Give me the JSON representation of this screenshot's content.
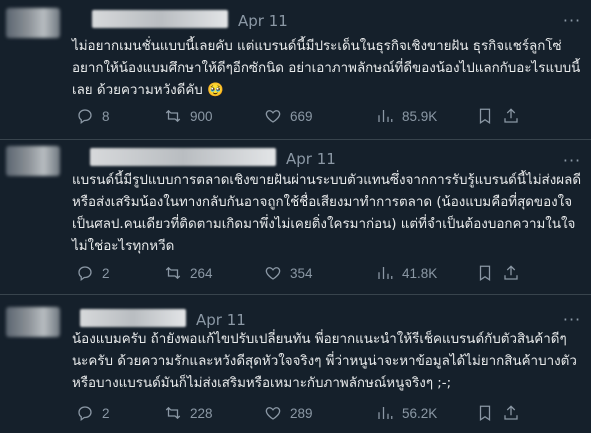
{
  "tweets": [
    {
      "date": "Apr 11",
      "text": "ไม่อยากเมนชั่นแบบนี้เลยคับ แต่แบรนด์นี้มีประเด็นในธุรกิจเชิงขายฝัน ธุรกิจแชร์ลูกโซ่ อยากให้น้องแบมศึกษาให้ดีๆอีกซักนิด อย่าเอาภาพลักษณ์ที่ดีของน้องไปแลกกับอะไรแบบนี้เลย ด้วยความหวังดีคับ 🥹",
      "replies": "8",
      "reposts": "900",
      "likes": "669",
      "views": "85.9K"
    },
    {
      "date": "Apr 11",
      "text": "แบรนด์นี้มีรูปแบบการตลาดเชิงขายฝันผ่านระบบตัวแทนซึ่งจากการรับรู้แบรนด์นี้ไม่ส่งผลดีหรือส่งเสริมน้องในทางกลับกันอาจถูกใช้ชื่อเสียงมาทำการตลาด (น้องแบมคือที่สุดของใจเป็นศลป.คนเดียวที่ติดตามเกิดมาพึ่งไม่เคยติ่งใครมาก่อน) แต่ที่จำเป็นต้องบอกความในใจไม่ใช่อะไรทุกหวีด",
      "replies": "2",
      "reposts": "264",
      "likes": "354",
      "views": "41.8K"
    },
    {
      "date": "Apr 11",
      "text": "น้องแบมครับ ถ้ายังพอแก้ไขปรับเปลี่ยนทัน พี่อยากแนะนำให้รีเช็คแบรนด์กับตัวสินค้าดีๆนะครับ ด้วยความรักและหวังดีสุดหัวใจจริงๆ  พี่ว่าหนูน่าจะหาข้อมูลได้ไม่ยากสินค้าบางตัวหรือบางแบรนด์มันก็ไม่ส่งเสริมหรือเหมาะกับภาพลักษณ์หนูจริงๆ  ;-;",
      "replies": "2",
      "reposts": "228",
      "likes": "289",
      "views": "56.2K"
    }
  ]
}
